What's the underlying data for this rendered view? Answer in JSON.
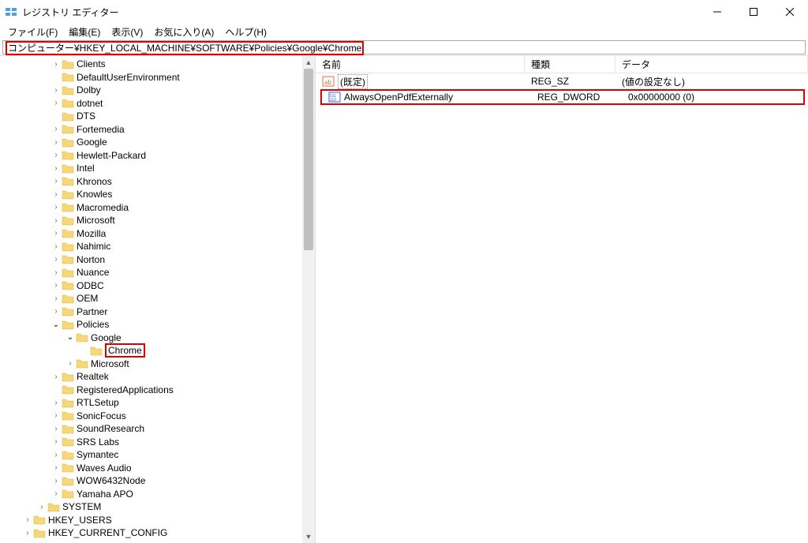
{
  "window": {
    "title": "レジストリ エディター"
  },
  "menu": {
    "file": "ファイル(F)",
    "edit": "編集(E)",
    "view": "表示(V)",
    "fav": "お気に入り(A)",
    "help": "ヘルプ(H)"
  },
  "address": {
    "path": "コンピューター¥HKEY_LOCAL_MACHINE¥SOFTWARE¥Policies¥Google¥Chrome"
  },
  "tree": {
    "items": [
      {
        "depth": 3,
        "exp": ">",
        "label": "Clients"
      },
      {
        "depth": 3,
        "exp": "",
        "label": "DefaultUserEnvironment"
      },
      {
        "depth": 3,
        "exp": ">",
        "label": "Dolby"
      },
      {
        "depth": 3,
        "exp": ">",
        "label": "dotnet"
      },
      {
        "depth": 3,
        "exp": "",
        "label": "DTS"
      },
      {
        "depth": 3,
        "exp": ">",
        "label": "Fortemedia"
      },
      {
        "depth": 3,
        "exp": ">",
        "label": "Google"
      },
      {
        "depth": 3,
        "exp": ">",
        "label": "Hewlett-Packard"
      },
      {
        "depth": 3,
        "exp": ">",
        "label": "Intel"
      },
      {
        "depth": 3,
        "exp": ">",
        "label": "Khronos"
      },
      {
        "depth": 3,
        "exp": ">",
        "label": "Knowles"
      },
      {
        "depth": 3,
        "exp": ">",
        "label": "Macromedia"
      },
      {
        "depth": 3,
        "exp": ">",
        "label": "Microsoft"
      },
      {
        "depth": 3,
        "exp": ">",
        "label": "Mozilla"
      },
      {
        "depth": 3,
        "exp": ">",
        "label": "Nahimic"
      },
      {
        "depth": 3,
        "exp": ">",
        "label": "Norton"
      },
      {
        "depth": 3,
        "exp": ">",
        "label": "Nuance"
      },
      {
        "depth": 3,
        "exp": ">",
        "label": "ODBC"
      },
      {
        "depth": 3,
        "exp": ">",
        "label": "OEM"
      },
      {
        "depth": 3,
        "exp": ">",
        "label": "Partner"
      },
      {
        "depth": 3,
        "exp": "v",
        "label": "Policies"
      },
      {
        "depth": 4,
        "exp": "v",
        "label": "Google"
      },
      {
        "depth": 5,
        "exp": "",
        "label": "Chrome",
        "selected": true
      },
      {
        "depth": 4,
        "exp": ">",
        "label": "Microsoft"
      },
      {
        "depth": 3,
        "exp": ">",
        "label": "Realtek"
      },
      {
        "depth": 3,
        "exp": "",
        "label": "RegisteredApplications"
      },
      {
        "depth": 3,
        "exp": ">",
        "label": "RTLSetup"
      },
      {
        "depth": 3,
        "exp": ">",
        "label": "SonicFocus"
      },
      {
        "depth": 3,
        "exp": ">",
        "label": "SoundResearch"
      },
      {
        "depth": 3,
        "exp": ">",
        "label": "SRS Labs"
      },
      {
        "depth": 3,
        "exp": ">",
        "label": "Symantec"
      },
      {
        "depth": 3,
        "exp": ">",
        "label": "Waves Audio"
      },
      {
        "depth": 3,
        "exp": ">",
        "label": "WOW6432Node"
      },
      {
        "depth": 3,
        "exp": ">",
        "label": "Yamaha APO"
      },
      {
        "depth": 2,
        "exp": ">",
        "label": "SYSTEM"
      },
      {
        "depth": 1,
        "exp": ">",
        "label": "HKEY_USERS"
      },
      {
        "depth": 1,
        "exp": ">",
        "label": "HKEY_CURRENT_CONFIG"
      }
    ]
  },
  "list": {
    "headers": {
      "name": "名前",
      "type": "種類",
      "data": "データ"
    },
    "rows": [
      {
        "icon": "sz",
        "name": "(既定)",
        "type": "REG_SZ",
        "data": "(値の設定なし)",
        "default": true
      },
      {
        "icon": "dw",
        "name": "AlwaysOpenPdfExternally",
        "type": "REG_DWORD",
        "data": "0x00000000 (0)",
        "highlight": true
      }
    ]
  }
}
